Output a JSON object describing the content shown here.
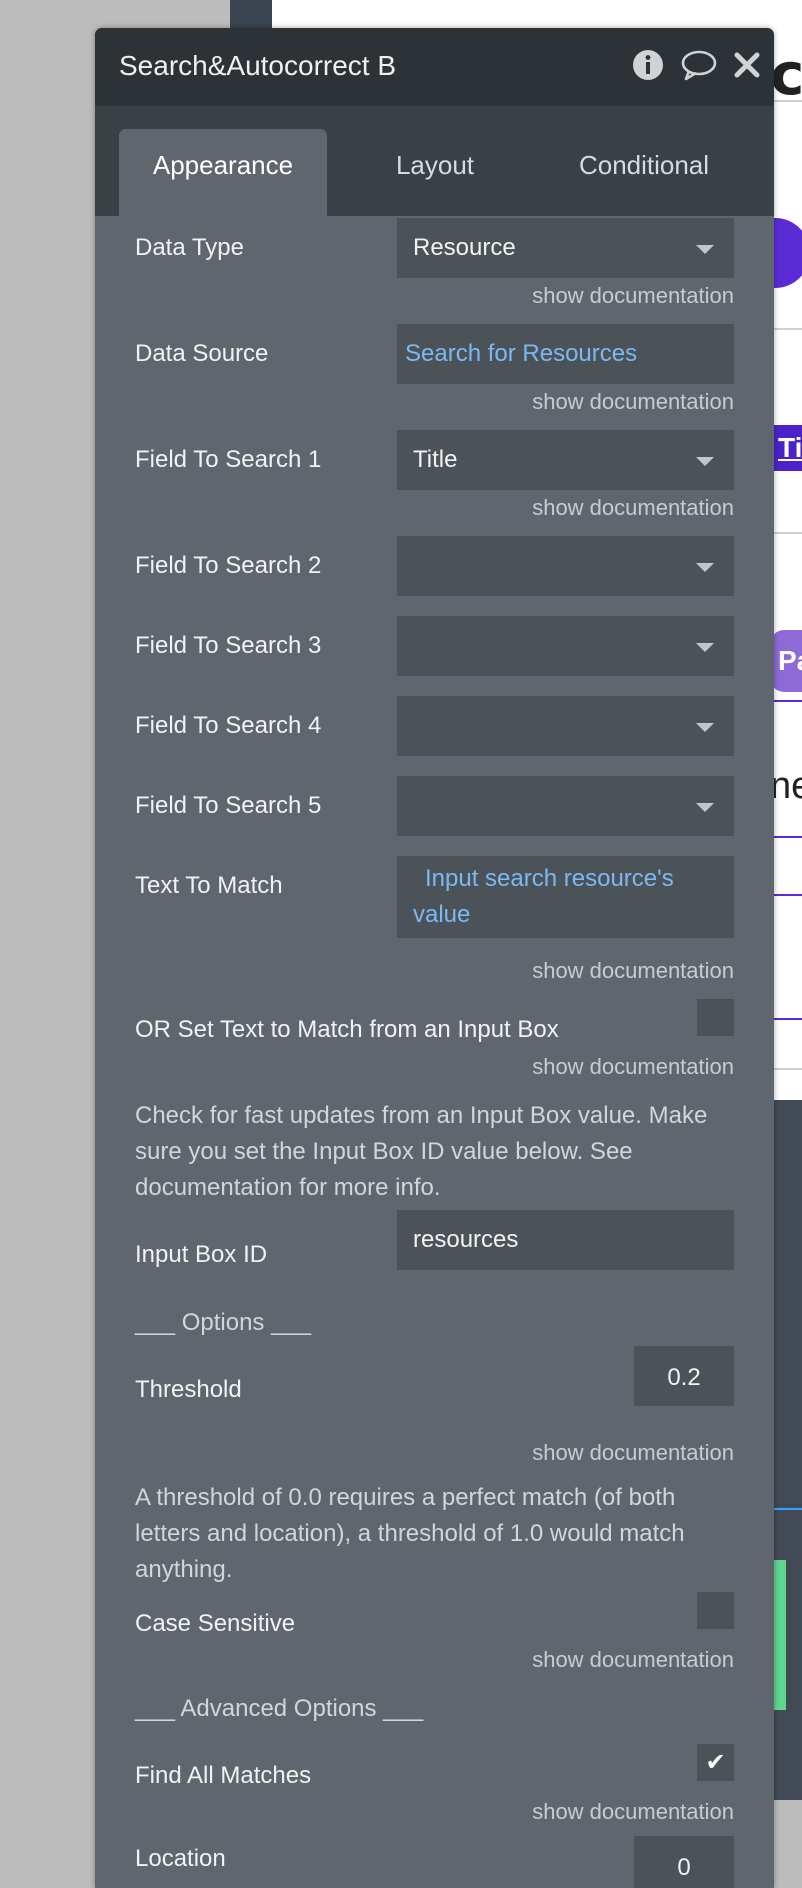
{
  "background": {
    "partial_heading_letter": "c",
    "partial_button_ti": "Ti",
    "partial_button_pa": "Pa",
    "partial_text_ne": "ne"
  },
  "panel": {
    "title": "Search&Autocorrect B",
    "title_icons": [
      "info-icon",
      "comment-icon",
      "close-icon"
    ],
    "tabs": [
      {
        "label": "Appearance",
        "active": true
      },
      {
        "label": "Layout",
        "active": false
      },
      {
        "label": "Conditional",
        "active": false
      }
    ],
    "doc_link": "show documentation",
    "fields": {
      "data_type": {
        "label": "Data Type",
        "value": "Resource"
      },
      "data_source": {
        "label": "Data Source",
        "value": "Search for Resources"
      },
      "field1": {
        "label": "Field To Search 1",
        "value": "Title"
      },
      "field2": {
        "label": "Field To Search 2",
        "value": ""
      },
      "field3": {
        "label": "Field To Search 3",
        "value": ""
      },
      "field4": {
        "label": "Field To Search 4",
        "value": ""
      },
      "field5": {
        "label": "Field To Search 5",
        "value": ""
      },
      "text_to_match": {
        "label": "Text To Match",
        "value_line1": "Input search resource's",
        "value_line2": "value"
      },
      "or_set_text": {
        "label": "OR Set Text to Match from an Input Box",
        "checked": false
      },
      "input_box_help": "Check for fast updates from an Input Box value. Make sure you set the Input Box ID value below. See documentation for more info.",
      "input_box_id": {
        "label": "Input Box ID",
        "value": "resources"
      },
      "options_header": "___ Options ___",
      "threshold": {
        "label": "Threshold",
        "value": "0.2"
      },
      "threshold_help": "A threshold of 0.0 requires a perfect match (of both letters and location), a threshold of 1.0 would match anything.",
      "case_sensitive": {
        "label": "Case Sensitive",
        "checked": false
      },
      "advanced_header": "___ Advanced Options ___",
      "find_all_matches": {
        "label": "Find All Matches",
        "checked": true,
        "check_mark": "✔"
      },
      "location": {
        "label": "Location",
        "value": "0"
      }
    }
  }
}
